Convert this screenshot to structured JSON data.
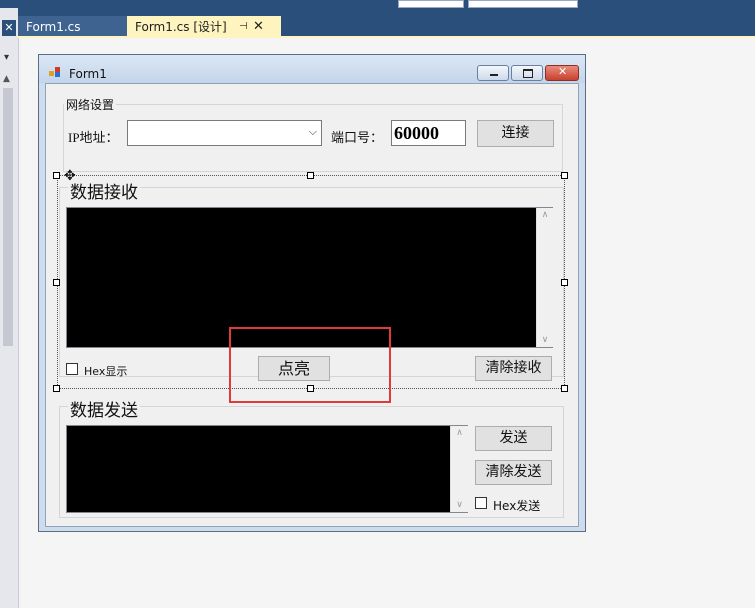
{
  "ide": {
    "tabs": [
      {
        "label": "Form1.cs"
      },
      {
        "label": "Form1.cs [设计]",
        "pin": "⊣",
        "close": "✕"
      }
    ]
  },
  "form": {
    "title": "Form1",
    "network_group": {
      "title": "网络设置",
      "ip_label": "IP地址：",
      "ip_value": "",
      "port_label": "端口号：",
      "port_value": "60000",
      "connect_label": "连接"
    },
    "receive_group": {
      "title": "数据接收",
      "hex_display_label": "Hex显示",
      "light_label": "点亮",
      "clear_label": "清除接收"
    },
    "send_group": {
      "title": "数据发送",
      "send_label": "发送",
      "clear_label": "清除发送",
      "hex_send_label": "Hex发送"
    }
  },
  "colors": {
    "ide_blue": "#2b4f7b",
    "active_tab": "#fdf4bf",
    "highlight_red": "#e03a3a"
  }
}
